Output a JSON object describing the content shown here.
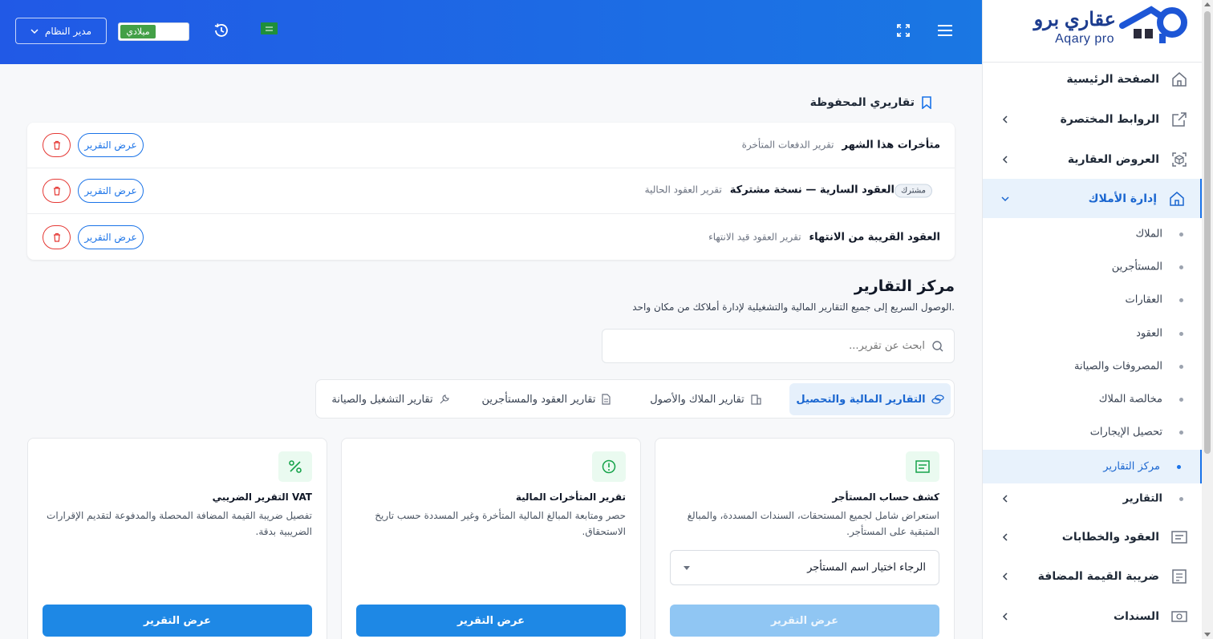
{
  "header": {
    "role_label": "مدير النظام",
    "calendar_label": "ميلادي"
  },
  "sidebar": {
    "logo_text": "عقاري برو",
    "logo_sub": "Aqary pro",
    "items": [
      {
        "label": "الصفحة الرئيسية"
      },
      {
        "label": "الروابط المختصرة"
      },
      {
        "label": "العروض العقارية"
      },
      {
        "label": "إدارة الأملاك"
      },
      {
        "label": "العقود والخطابات"
      },
      {
        "label": "ضريبة القيمة المضافة"
      },
      {
        "label": "السندات"
      }
    ],
    "sub_items": [
      {
        "label": "الملاك"
      },
      {
        "label": "المستأجرين"
      },
      {
        "label": "العقارات"
      },
      {
        "label": "العقود"
      },
      {
        "label": "المصروفات والصيانة"
      },
      {
        "label": "مخالصة الملاك"
      },
      {
        "label": "تحصيل الإيجارات"
      },
      {
        "label": "مركز التقارير"
      },
      {
        "label": "التقارير"
      }
    ]
  },
  "saved": {
    "title": "تقاريري المحفوظة",
    "shared_badge": "مشترك",
    "view_label": "عرض التقرير",
    "rows": [
      {
        "name": "متأخرات هذا الشهر",
        "type": "تقرير الدفعات المتأخرة"
      },
      {
        "name": "العقود السارية — نسخة مشتركة",
        "type": "تقرير العقود الحالية"
      },
      {
        "name": "العقود القريبة من الانتهاء",
        "type": "تقرير العقود قيد الانتهاء"
      }
    ]
  },
  "hub": {
    "title": "مركز التقارير",
    "description": "الوصول السريع إلى جميع التقارير المالية والتشغيلية لإدارة أملاكك من مكان واحد.",
    "search_placeholder": "ابحث عن تقرير..."
  },
  "tabs": [
    {
      "label": "التقارير المالية والتحصيل"
    },
    {
      "label": "تقارير الملاك والأصول"
    },
    {
      "label": "تقارير العقود والمستأجرين"
    },
    {
      "label": "تقارير التشغيل والصيانة"
    }
  ],
  "cards": [
    {
      "title": "كشف حساب المستأجر",
      "description": "استعراض شامل لجميع المستحقات، السندات المسددة، والمبالغ المتبقية على المستأجر.",
      "select_value": "الرجاء اختيار اسم المستأجر",
      "button": "عرض التقرير",
      "button_enabled": false,
      "icon": "receipt-icon"
    },
    {
      "title": "تقرير المتأخرات المالية",
      "description": "حصر ومتابعة المبالغ المالية المتأخرة وغير المسددة حسب تاريخ الاستحقاق.",
      "button": "عرض التقرير",
      "button_enabled": true,
      "icon": "alert-circle-icon"
    },
    {
      "title": "التقرير الضريبي VAT",
      "description": "تفصيل ضريبة القيمة المضافة المحصلة والمدفوعة لتقديم الإقرارات الضريبية بدقة.",
      "button": "عرض التقرير",
      "button_enabled": true,
      "icon": "percent-icon"
    }
  ],
  "colors": {
    "header_start": "#2159e6",
    "header_end": "#1a77e3",
    "accent": "#1a73e8",
    "danger": "#e53935",
    "success": "#43a047"
  }
}
